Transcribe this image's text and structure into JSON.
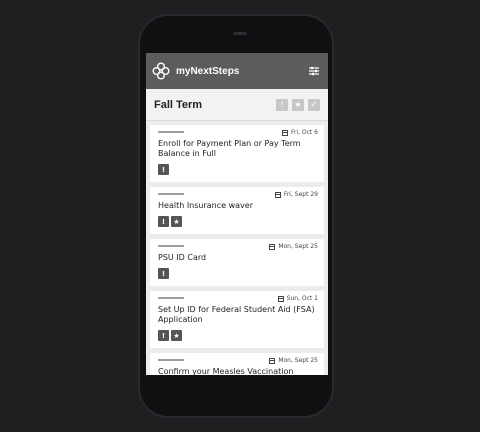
{
  "app": {
    "title": "myNextSteps"
  },
  "term": {
    "title": "Fall Term",
    "actions": [
      "!",
      "★",
      "✓"
    ]
  },
  "cards": [
    {
      "date": "Fri, Oct 6",
      "title": "Enroll for Payment Plan or Pay Term Balance in Full",
      "tags": [
        "!"
      ]
    },
    {
      "date": "Fri, Sept 29",
      "title": "Health Insurance waver",
      "tags": [
        "!",
        "★"
      ]
    },
    {
      "date": "Mon, Sept 25",
      "title": "PSU ID Card",
      "tags": [
        "!"
      ]
    },
    {
      "date": "Sun, Oct 1",
      "title": "Set Up ID for Federal Student Aid (FSA) Application",
      "tags": [
        "!",
        "★"
      ]
    },
    {
      "date": "Mon, Sept 25",
      "title": "Confirm your Measles Vaccination",
      "tags": []
    }
  ],
  "colors": {
    "appbar": "#5c5c5c",
    "background": "#ececec"
  }
}
